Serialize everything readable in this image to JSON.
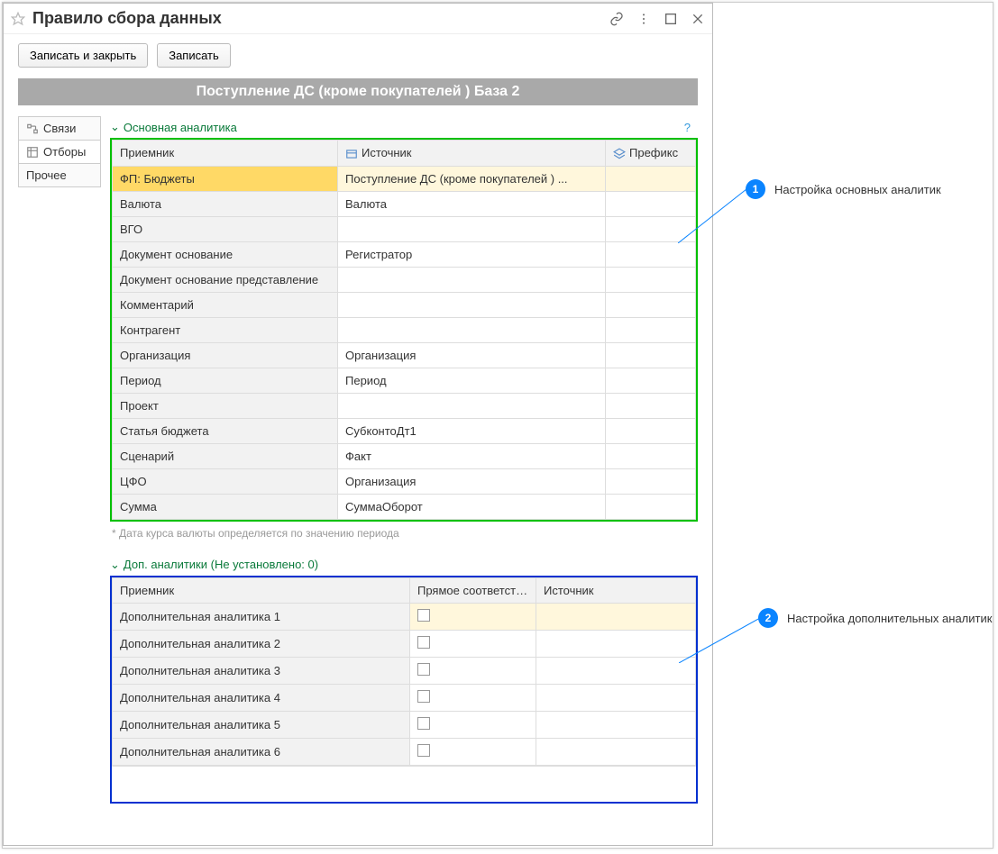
{
  "window": {
    "title": "Правило сбора данных"
  },
  "toolbar": {
    "save_close": "Записать и закрыть",
    "save": "Записать"
  },
  "banner": "Поступление ДС (кроме покупателей ) База 2",
  "tabs": {
    "links": "Связи",
    "filters": "Отборы",
    "other": "Прочее"
  },
  "group1": {
    "title": "Основная аналитика",
    "help": "?",
    "columns": {
      "receiver": "Приемник",
      "source": "Источник",
      "prefix": "Префикс"
    },
    "rows": [
      {
        "receiver": "ФП: Бюджеты",
        "source": "Поступление ДС (кроме покупателей ) ...",
        "prefix": "",
        "selected": true
      },
      {
        "receiver": "Валюта",
        "source": "Валюта",
        "prefix": ""
      },
      {
        "receiver": "ВГО",
        "source": "",
        "prefix": ""
      },
      {
        "receiver": "Документ основание",
        "source": "Регистратор",
        "prefix": ""
      },
      {
        "receiver": "Документ основание представление",
        "source": "",
        "prefix": ""
      },
      {
        "receiver": "Комментарий",
        "source": "",
        "prefix": ""
      },
      {
        "receiver": "Контрагент",
        "source": "",
        "prefix": ""
      },
      {
        "receiver": "Организация",
        "source": "Организация",
        "prefix": ""
      },
      {
        "receiver": "Период",
        "source": "Период",
        "prefix": ""
      },
      {
        "receiver": "Проект",
        "source": "",
        "prefix": ""
      },
      {
        "receiver": "Статья бюджета",
        "source": "СубконтоДт1",
        "prefix": ""
      },
      {
        "receiver": "Сценарий",
        "source": "Факт",
        "prefix": ""
      },
      {
        "receiver": "ЦФО",
        "source": "Организация",
        "prefix": ""
      },
      {
        "receiver": "Сумма",
        "source": "СуммаОборот",
        "prefix": ""
      }
    ],
    "footnote": "* Дата курса валюты определяется по значению периода"
  },
  "group2": {
    "title": "Доп. аналитики (Не установлено: 0)",
    "columns": {
      "receiver": "Приемник",
      "direct": "Прямое соответствие",
      "source": "Источник"
    },
    "rows": [
      {
        "receiver": "Дополнительная аналитика 1",
        "direct": false,
        "source": "",
        "selected": true
      },
      {
        "receiver": "Дополнительная аналитика 2",
        "direct": false,
        "source": ""
      },
      {
        "receiver": "Дополнительная аналитика 3",
        "direct": false,
        "source": ""
      },
      {
        "receiver": "Дополнительная аналитика 4",
        "direct": false,
        "source": ""
      },
      {
        "receiver": "Дополнительная аналитика 5",
        "direct": false,
        "source": ""
      },
      {
        "receiver": "Дополнительная аналитика 6",
        "direct": false,
        "source": ""
      }
    ]
  },
  "callouts": {
    "c1": {
      "num": "1",
      "text": "Настройка основных аналитик"
    },
    "c2": {
      "num": "2",
      "text": "Настройка дополнительных аналитик"
    }
  }
}
